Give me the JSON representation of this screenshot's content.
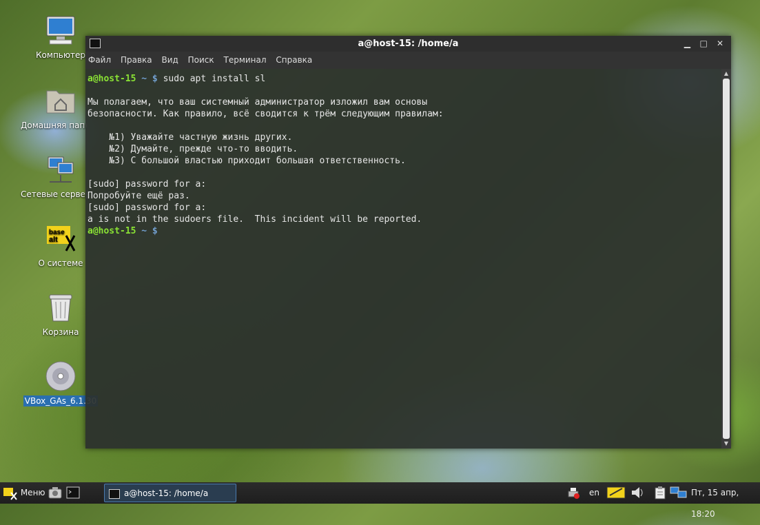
{
  "desktop": {
    "icons": [
      {
        "label": "Компьютер",
        "icon": "computer-icon"
      },
      {
        "label": "Домашняя папка",
        "icon": "home-folder-icon"
      },
      {
        "label": "Сетевые серверы",
        "icon": "network-servers-icon"
      },
      {
        "label": "О системе",
        "icon": "basealt-logo-icon"
      },
      {
        "label": "Корзина",
        "icon": "trash-icon"
      },
      {
        "label": "VBox_GAs_6.1.30",
        "icon": "cd-disc-icon"
      }
    ]
  },
  "window": {
    "title": "a@host-15: /home/a",
    "controls": {
      "minimize": "▁",
      "maximize": "□",
      "close": "✕"
    },
    "menu": [
      "Файл",
      "Правка",
      "Вид",
      "Поиск",
      "Терминал",
      "Справка"
    ]
  },
  "terminal": {
    "prompt_user": "a@host-15",
    "prompt_rest": " ~ $",
    "command": " sudo apt install sl",
    "lecture": [
      "Мы полагаем, что ваш системный администратор изложил вам основы",
      "безопасности. Как правило, всё сводится к трём следующим правилам:",
      "",
      "    №1) Уважайте частную жизнь других.",
      "    №2) Думайте, прежде что-то вводить.",
      "    №3) С большой властью приходит большая ответственность.",
      ""
    ],
    "output": [
      "[sudo] password for a:",
      "Попробуйте ещё раз.",
      "[sudo] password for a:",
      "a is not in the sudoers file.  This incident will be reported."
    ]
  },
  "taskbar": {
    "menu_label": "Меню",
    "task_label": "a@host-15: /home/a",
    "lang": "en",
    "clock": "Пт, 15 апр, 18:20"
  },
  "colors": {
    "prompt_user": "#8ae234",
    "prompt_path": "#729fcf",
    "task_active_border": "#4a7cb0"
  }
}
